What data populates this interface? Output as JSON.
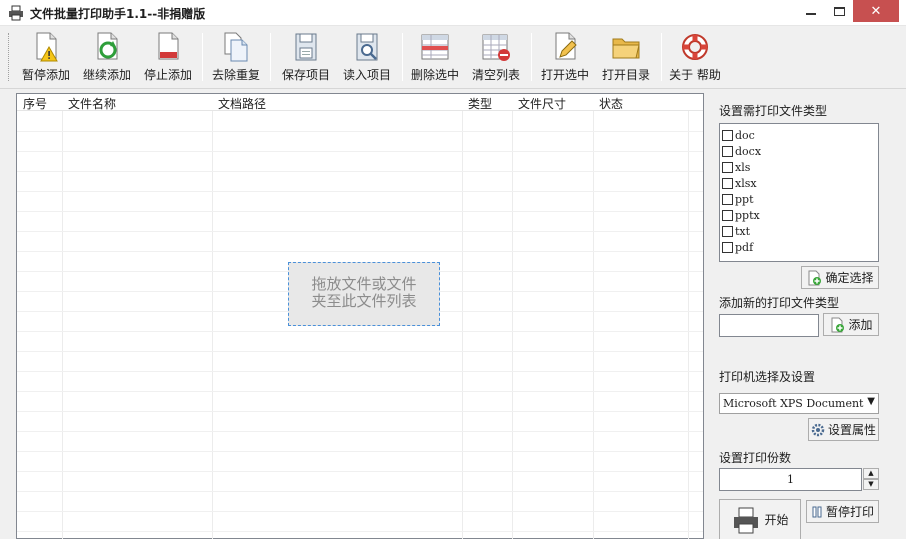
{
  "window": {
    "title": "文件批量打印助手1.1--非捐赠版",
    "close_glyph": "✕"
  },
  "toolbar": {
    "items": [
      {
        "label": "暂停添加",
        "icon": "warning-document-icon"
      },
      {
        "label": "继续添加",
        "icon": "refresh-document-icon"
      },
      {
        "label": "停止添加",
        "icon": "stop-document-icon"
      },
      {
        "label": "去除重复",
        "icon": "duplicate-documents-icon"
      },
      {
        "label": "保存项目",
        "icon": "save-project-icon"
      },
      {
        "label": "读入项目",
        "icon": "load-project-icon"
      },
      {
        "label": "删除选中",
        "icon": "delete-selected-icon"
      },
      {
        "label": "清空列表",
        "icon": "clear-list-icon"
      },
      {
        "label": "打开选中",
        "icon": "open-selected-icon"
      },
      {
        "label": "打开目录",
        "icon": "folder-icon"
      },
      {
        "label": "关于 帮助",
        "icon": "lifebuoy-icon"
      }
    ]
  },
  "file_list": {
    "columns": [
      "序号",
      "文件名称",
      "文档路径",
      "类型",
      "文件尺寸",
      "状态"
    ],
    "rows": [],
    "drop_hint_line1": "拖放文件或文件",
    "drop_hint_line2": "夹至此文件列表"
  },
  "types_panel": {
    "label": "设置需打印文件类型",
    "types": [
      {
        "name": "doc",
        "checked": false
      },
      {
        "name": "docx",
        "checked": false
      },
      {
        "name": "xls",
        "checked": false
      },
      {
        "name": "xlsx",
        "checked": false
      },
      {
        "name": "ppt",
        "checked": false
      },
      {
        "name": "pptx",
        "checked": false
      },
      {
        "name": "txt",
        "checked": false
      },
      {
        "name": "pdf",
        "checked": false
      }
    ],
    "confirm_label": "确定选择"
  },
  "add_type": {
    "label": "添加新的打印文件类型",
    "value": "",
    "add_label": "添加"
  },
  "printer": {
    "label": "打印机选择及设置",
    "selected": "Microsoft XPS Document",
    "properties_label": "设置属性"
  },
  "copies": {
    "label": "设置打印份数",
    "value": "1"
  },
  "actions": {
    "start_label": "开始",
    "pause_label": "暂停打印"
  },
  "colors": {
    "close_button": "#c75050",
    "drop_zone_border": "#4a90d9"
  }
}
